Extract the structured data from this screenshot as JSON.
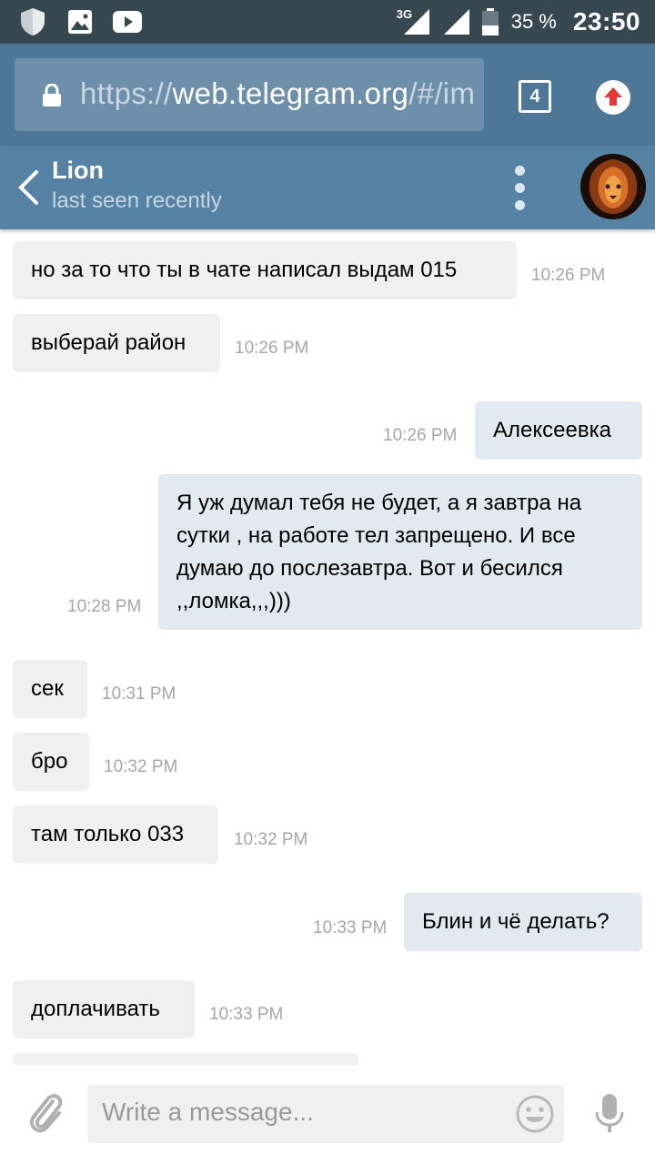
{
  "status_bar": {
    "network": "3G",
    "battery": "35 %",
    "time": "23:50",
    "icons": [
      "shield-icon",
      "image-icon",
      "youtube-icon",
      "signal-icon",
      "battery-icon"
    ]
  },
  "browser": {
    "url_prefix": "https://",
    "url_host": "web.telegram.org",
    "url_suffix": "/#/im",
    "tab_count": "4"
  },
  "chat_header": {
    "name": "Lion",
    "status": "last seen recently"
  },
  "messages": [
    {
      "side": "in",
      "text": "но за то что ты в чате написал выдам 015",
      "time": "10:26 PM"
    },
    {
      "side": "in",
      "text": "выберай район",
      "time": "10:26 PM"
    },
    {
      "side": "out",
      "text": "Алексеевка",
      "time": "10:26 PM"
    },
    {
      "side": "out",
      "text": "Я уж думал тебя не будет, а я завтра на сутки , на работе тел запрещено. И все думаю до послезавтра. Вот и бесился ,,ломка,,,)))",
      "time": "10:28 PM"
    },
    {
      "side": "in",
      "text": "сек",
      "time": "10:31 PM"
    },
    {
      "side": "in",
      "text": "бро",
      "time": "10:32 PM"
    },
    {
      "side": "in",
      "text": "там только 033",
      "time": "10:32 PM"
    },
    {
      "side": "out",
      "text": "Блин и чё делать?",
      "time": "10:33 PM"
    },
    {
      "side": "in",
      "text": "доплачивать",
      "time": "10:33 PM"
    }
  ],
  "composer": {
    "placeholder": "Write a message..."
  },
  "colors": {
    "status_bar": "#37474f",
    "browser_bar": "#4e7797",
    "chat_header": "#5682a3",
    "incoming_bubble": "#f0f0f0",
    "outgoing_bubble": "#e3e9f0"
  }
}
